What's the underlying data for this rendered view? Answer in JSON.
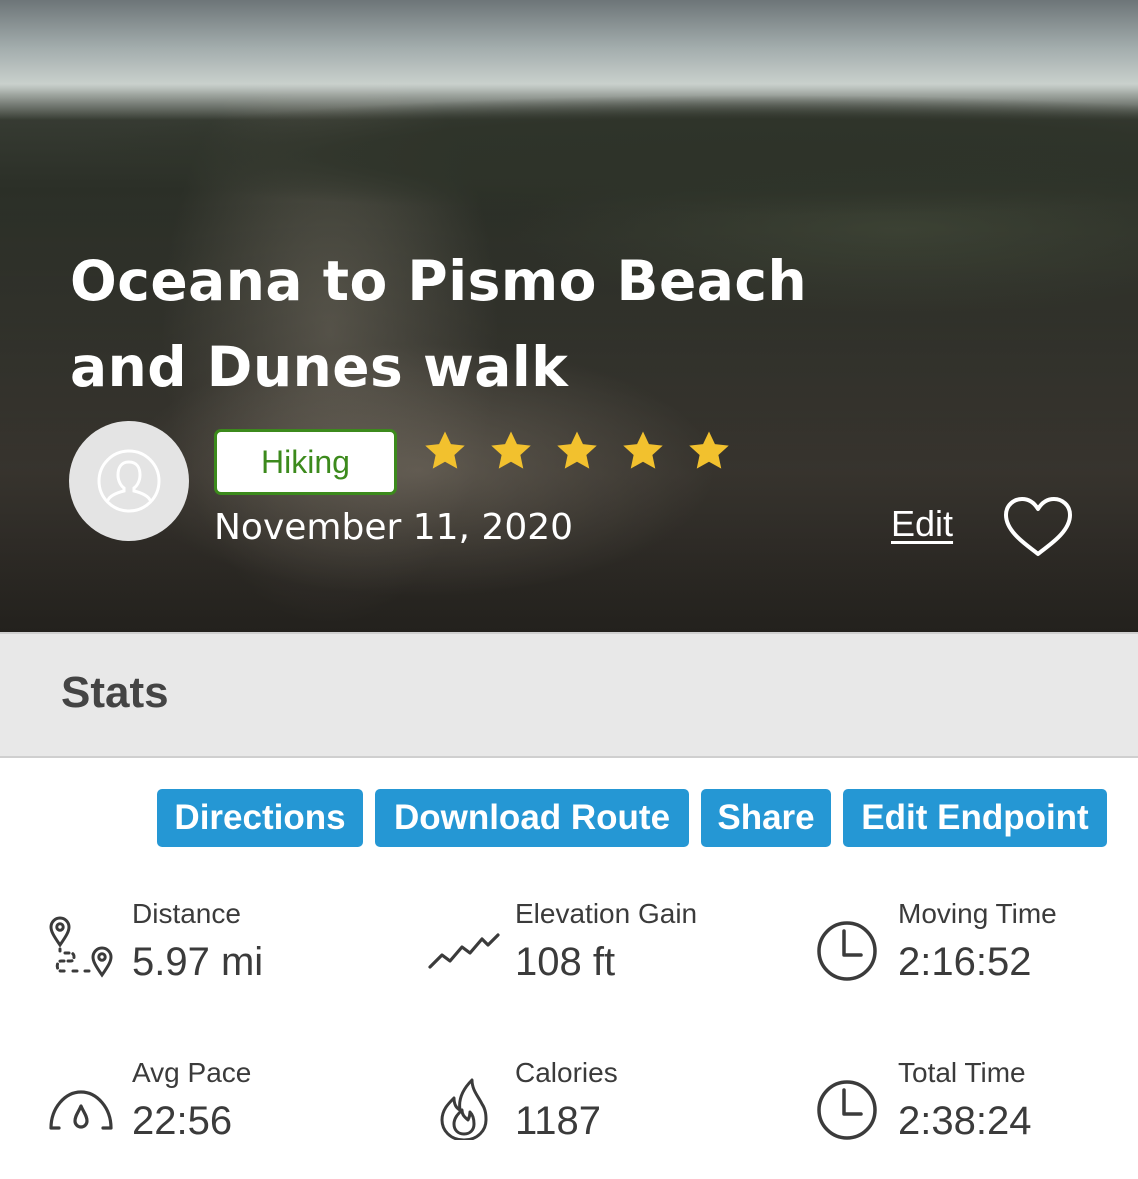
{
  "hero": {
    "title": "Oceana to Pismo Beach and Dunes walk",
    "activity": "Hiking",
    "rating": 5,
    "date": "November 11, 2020",
    "edit_label": "Edit",
    "star_color": "#f2c12e",
    "activity_color": "#3c8a1c"
  },
  "stats_section": {
    "title": "Stats"
  },
  "actions": {
    "directions": "Directions",
    "download_route": "Download Route",
    "share": "Share",
    "edit_endpoint": "Edit Endpoint",
    "button_color": "#2597d4"
  },
  "stats": {
    "distance": {
      "label": "Distance",
      "value": "5.97 mi",
      "icon": "route-icon"
    },
    "elevation": {
      "label": "Elevation Gain",
      "value": "108 ft",
      "icon": "elevation-icon"
    },
    "moving_time": {
      "label": "Moving Time",
      "value": "2:16:52",
      "icon": "clock-icon"
    },
    "avg_pace": {
      "label": "Avg Pace",
      "value": "22:56",
      "icon": "speedometer-icon"
    },
    "calories": {
      "label": "Calories",
      "value": "1187",
      "icon": "flame-icon"
    },
    "total_time": {
      "label": "Total Time",
      "value": "2:38:24",
      "icon": "clock-icon"
    }
  }
}
